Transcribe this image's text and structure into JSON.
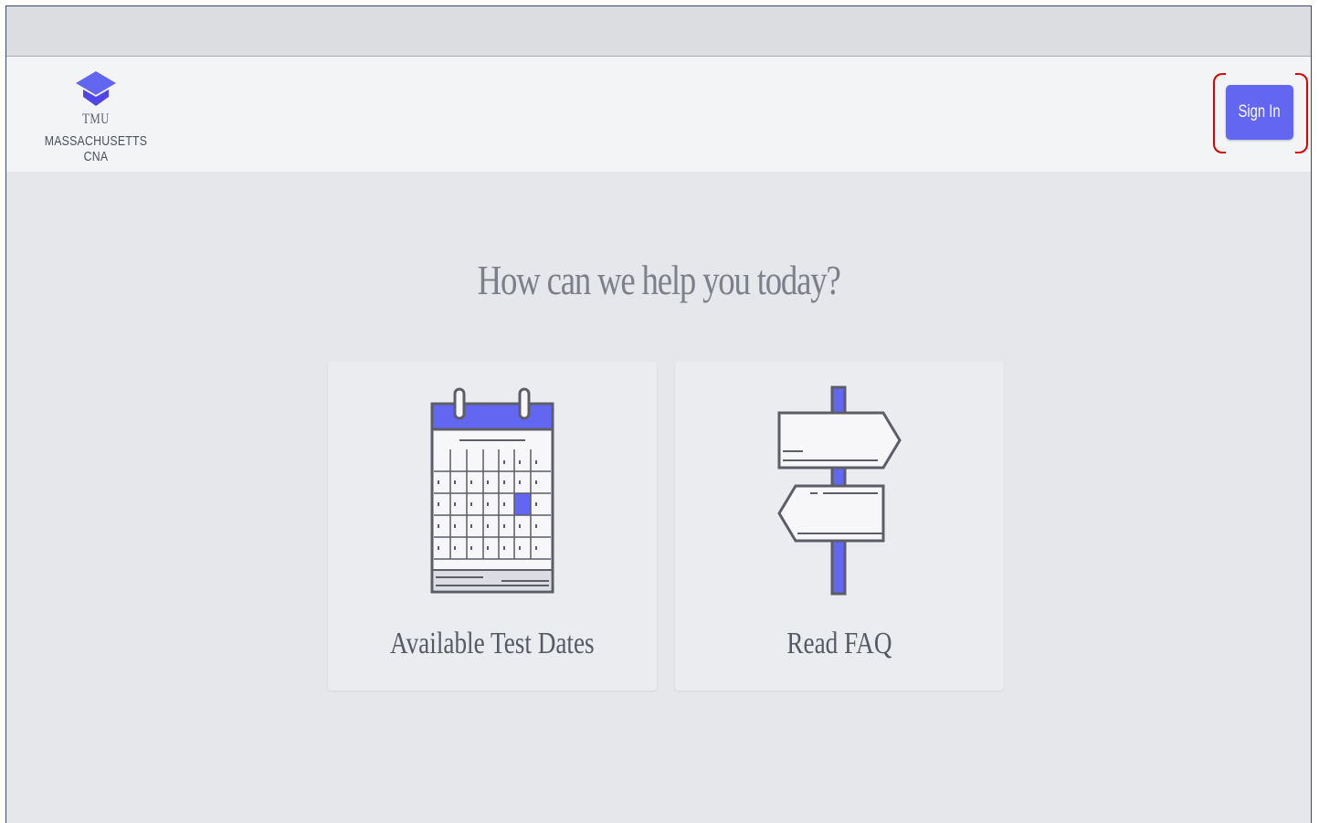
{
  "logo": {
    "icon": "graduation-cap-icon",
    "brand": "TMU",
    "subtitle": "MASSACHUSETTS CNA"
  },
  "header": {
    "signin_label": "Sign In"
  },
  "main": {
    "headline": "How can we help you today?",
    "cards": [
      {
        "label": "Available Test Dates",
        "icon": "calendar-icon"
      },
      {
        "label": "Read FAQ",
        "icon": "signpost-icon"
      }
    ]
  },
  "colors": {
    "accent": "#6366f1",
    "highlight": "#dc0000",
    "background": "#e5e7eb",
    "header": "#f3f4f6"
  }
}
